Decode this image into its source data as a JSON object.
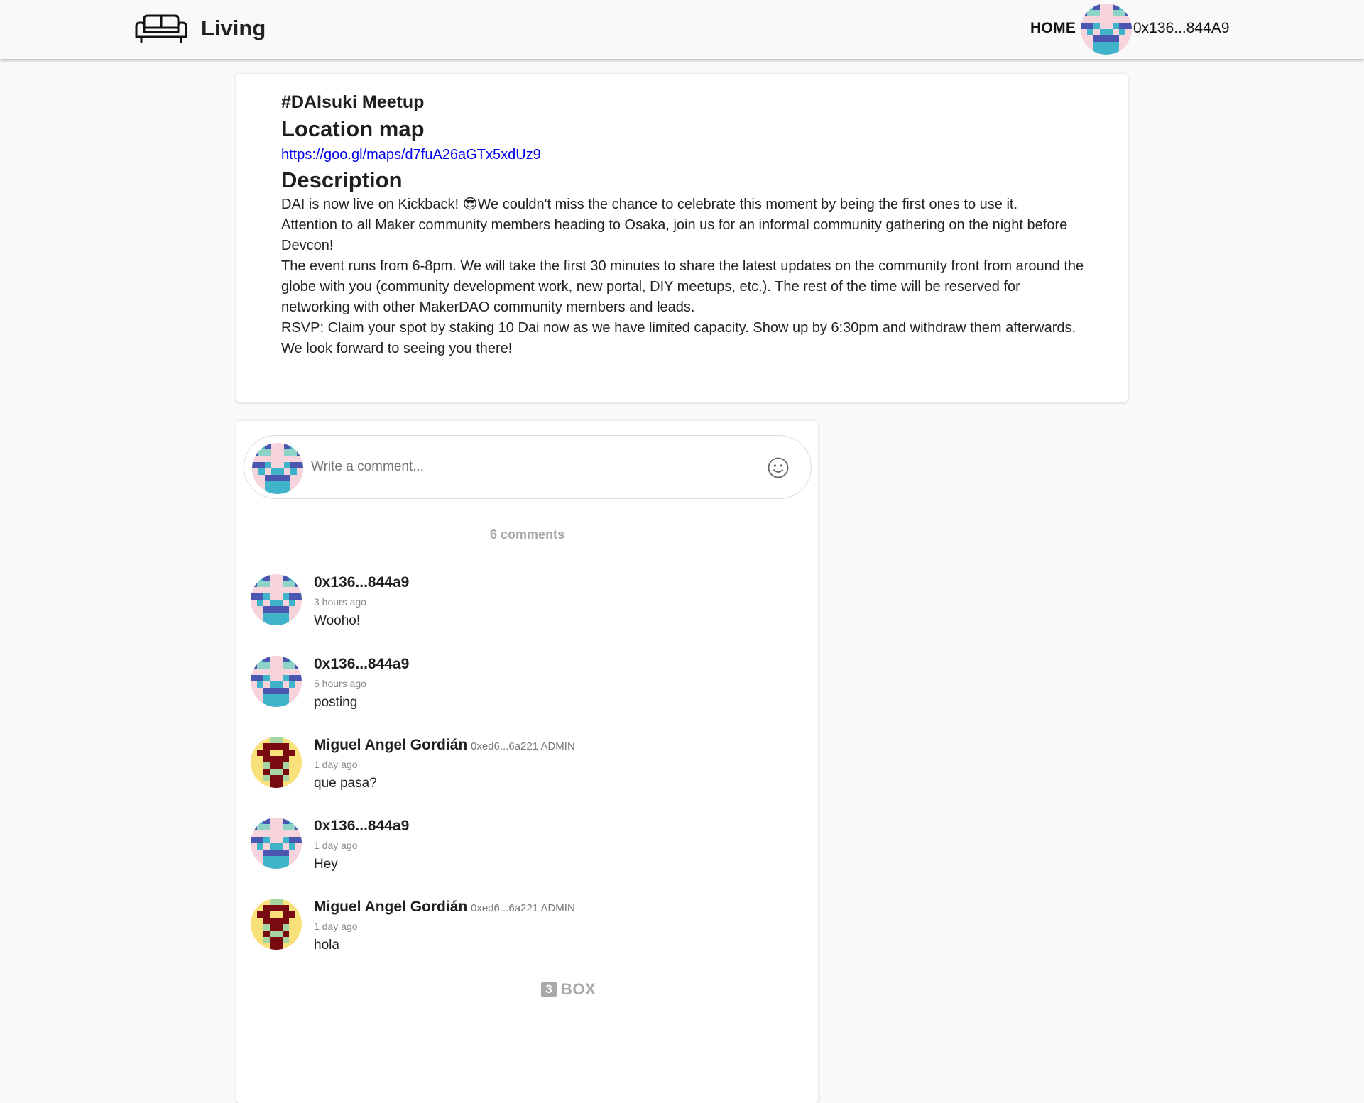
{
  "header": {
    "app_name": "Living",
    "logo_icon": "sofa-icon",
    "nav_home": "HOME",
    "user_address": "0x136...844A9"
  },
  "event": {
    "title": "#DAIsuki Meetup",
    "location_heading": "Location map",
    "map_url": "https://goo.gl/maps/d7fuA26aGTx5xdUz9",
    "description_heading": "Description",
    "description_lines": [
      "DAI is now live on Kickback! 😎We couldn't miss the chance to celebrate this moment by being the first ones to use it.",
      "Attention to all Maker community members heading to Osaka, join us for an informal community gathering on the night before Devcon!",
      "The event runs from 6-8pm. We will take the first 30 minutes to share the latest updates on the community front from around the globe with you (community development work, new portal, DIY meetups, etc.). The rest of the time will be reserved for networking with other MakerDAO community members and leads.",
      "RSVP: Claim your spot by staking 10 Dai now as we have limited capacity. Show up by 6:30pm and withdraw them afterwards.",
      "We look forward to seeing you there!"
    ]
  },
  "comments_section": {
    "input_placeholder": "Write a comment...",
    "emoji_icon": "smiley-icon",
    "count_label": "6 comments",
    "comments": [
      {
        "author": "0x136...844a9",
        "address": "",
        "role": "",
        "time": "3 hours ago",
        "body": "Wooho!",
        "avatar": "pink"
      },
      {
        "author": "0x136...844a9",
        "address": "",
        "role": "",
        "time": "5 hours ago",
        "body": "posting",
        "avatar": "pink"
      },
      {
        "author": "Miguel Angel Gordián",
        "address": "0xed6...6a221",
        "role": "ADMIN",
        "time": "1 day ago",
        "body": "que pasa?",
        "avatar": "yellow"
      },
      {
        "author": "0x136...844a9",
        "address": "",
        "role": "",
        "time": "1 day ago",
        "body": "Hey",
        "avatar": "pink"
      },
      {
        "author": "Miguel Angel Gordián",
        "address": "0xed6...6a221",
        "role": "ADMIN",
        "time": "1 day ago",
        "body": "hola",
        "avatar": "yellow"
      }
    ],
    "brand_badge": "3",
    "brand_text": "BOX"
  },
  "colors": {
    "link": "#0000ee",
    "muted": "#a8a8a8",
    "avatar_pink_bg": "#f7d3dc",
    "avatar_pink_a": "#3fb3c9",
    "avatar_pink_b": "#4a56b0",
    "avatar_pink_c": "#8fd3c8",
    "avatar_yellow_bg": "#f8e17a",
    "avatar_yellow_a": "#7a0a12",
    "avatar_yellow_b": "#a7d6a2"
  }
}
